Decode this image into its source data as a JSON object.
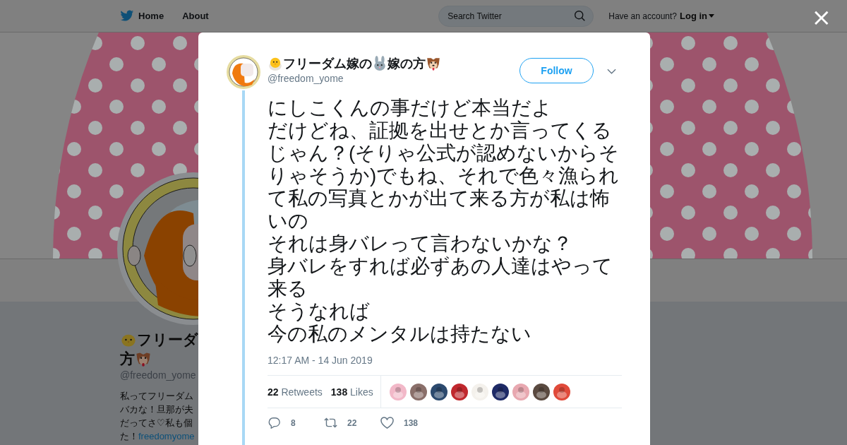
{
  "nav": {
    "items": [
      {
        "label": "Home",
        "kind": "home"
      },
      {
        "label": "About",
        "kind": "plain"
      }
    ],
    "search": {
      "placeholder": "Search Twitter"
    },
    "account_prompt": "Have an account?",
    "login": "Log in"
  },
  "profile": {
    "name_line1": "フリーダ",
    "name_line2": "方",
    "handle": "@freedom_yome",
    "bio": [
      "私ってフリーダム",
      "バカな！旦那が夫",
      "だってさ♡私も個"
    ],
    "bio_last": {
      "text": "た！",
      "link": "freedomyome"
    }
  },
  "modal": {
    "close": "×",
    "tweet": {
      "name_parts": [
        {
          "kind": "chick"
        },
        {
          "kind": "text",
          "text": "フリーダム嫁の"
        },
        {
          "kind": "rabbit"
        },
        {
          "kind": "text",
          "text": "嫁の方"
        },
        {
          "kind": "dog"
        }
      ],
      "handle": "@freedom_yome",
      "follow": "Follow",
      "text_lines": [
        "にしこくんの事だけど本当だよ",
        "だけどね、証拠を出せとか言ってくるじゃん？(そりゃ公式が認めないからそりゃそうか)でもね、それで色々漁られて私の写真とかが出て来る方が私は怖いの",
        "それは身バレって言わないかな？",
        "身バレをすれば必ずあの人達はやって来る",
        "そうなれば",
        "今の私のメンタルは持たない"
      ],
      "timestamp": "12:17 AM - 14 Jun 2019",
      "retweets": {
        "count": "22",
        "label": "Retweets"
      },
      "likes": {
        "count": "138",
        "label": "Likes"
      },
      "liker_avatars": [
        {
          "color": "#f2b8c8"
        },
        {
          "color": "#8a6f6a"
        },
        {
          "color": "#2c4a6e"
        },
        {
          "color": "#c0282e"
        },
        {
          "color": "#f4f1ec"
        },
        {
          "color": "#1e2a66"
        },
        {
          "color": "#e8a8b0"
        },
        {
          "color": "#5a4a40"
        },
        {
          "color": "#e04a3a"
        }
      ],
      "actions": [
        {
          "kind": "reply",
          "count": "8"
        },
        {
          "kind": "retweet",
          "count": "22"
        },
        {
          "kind": "like",
          "count": "138"
        }
      ]
    }
  }
}
